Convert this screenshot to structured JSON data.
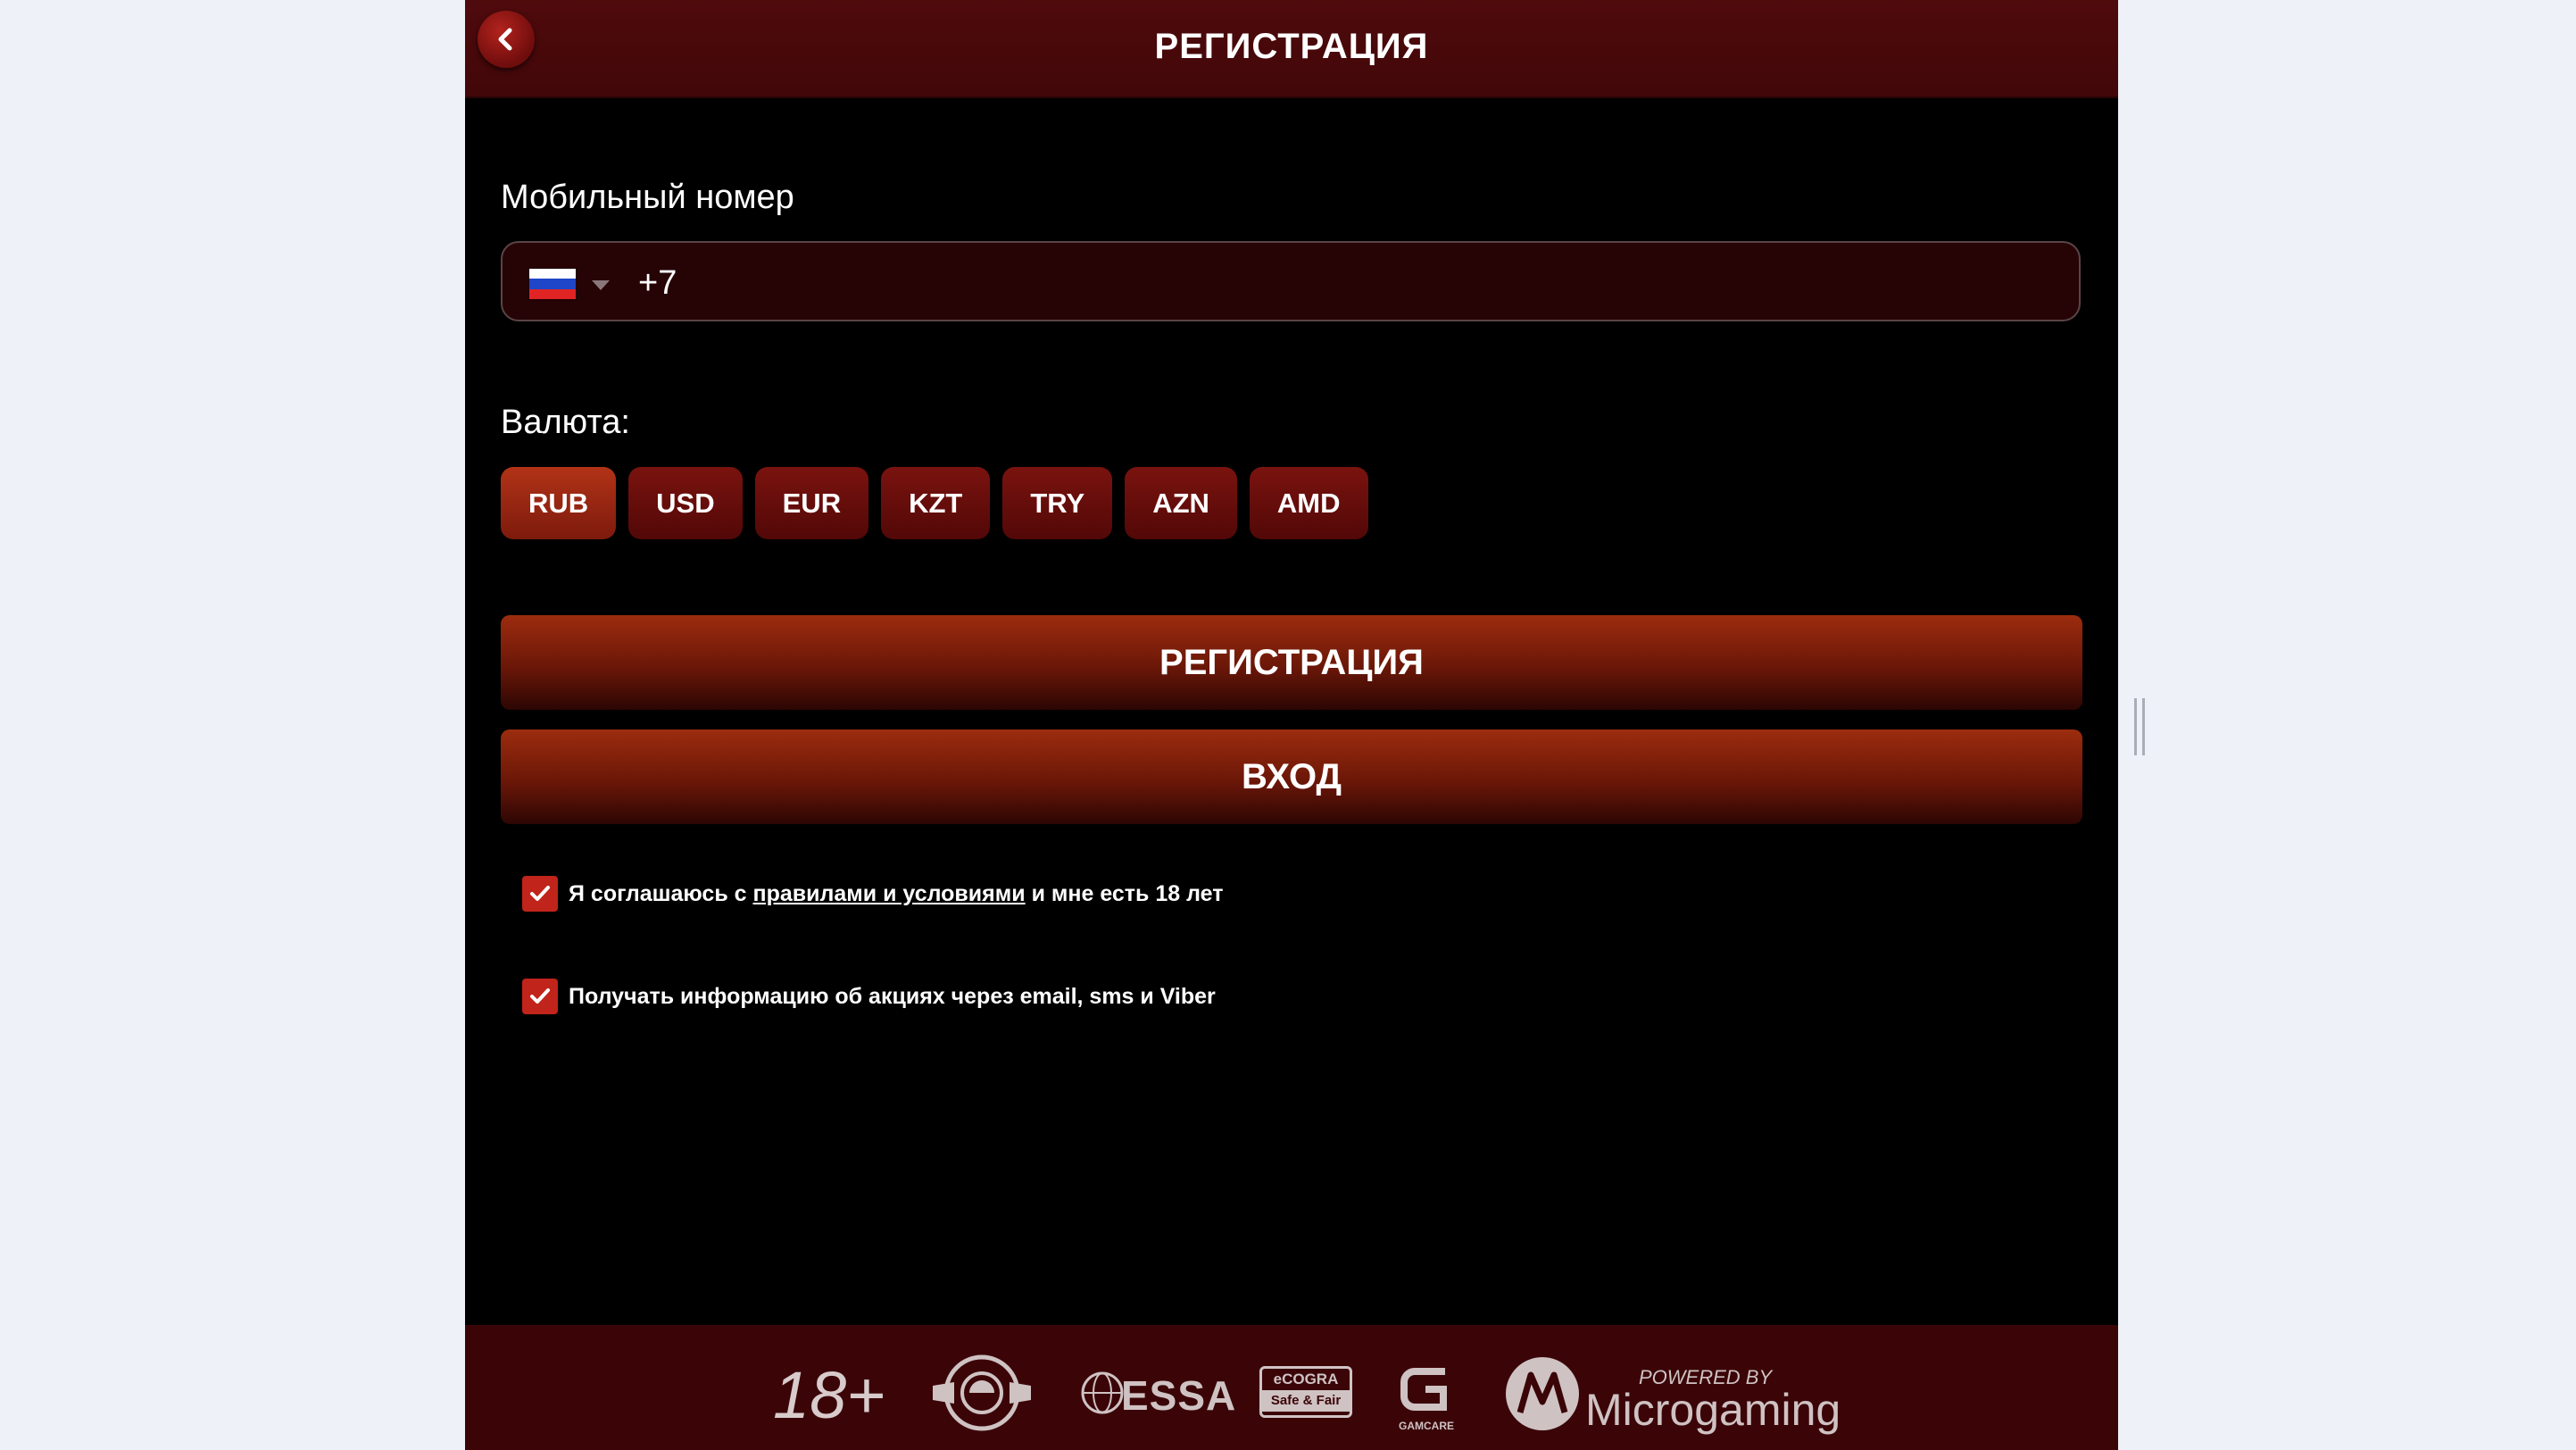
{
  "header": {
    "title": "РЕГИСТРАЦИЯ"
  },
  "phone": {
    "label": "Мобильный номер",
    "country": "RU",
    "prefix": "+7"
  },
  "currency": {
    "label": "Валюта:",
    "options": [
      "RUB",
      "USD",
      "EUR",
      "KZT",
      "TRY",
      "AZN",
      "AMD"
    ],
    "selected": "RUB"
  },
  "buttons": {
    "register": "РЕГИСТРАЦИЯ",
    "login": "ВХОД"
  },
  "terms": {
    "before": "Я соглашаюсь с ",
    "link": "правилами и условиями",
    "after": " и мне есть 18 лет",
    "checked": true
  },
  "promo": {
    "text": "Получать информацию об акциях через email, sms и Viber",
    "checked": true
  },
  "footer": {
    "age": "18+",
    "essa": "ESSA",
    "ecogra_top": "eCOGRA",
    "ecogra_bottom": "Safe & Fair",
    "gamcare": "GAMCARE",
    "powered_by": "POWERED BY",
    "microgaming": "Microgaming"
  },
  "colors": {
    "header": "#4a0709",
    "footer": "#3b0508",
    "accent": "#c1241a",
    "active_currency": "#b23316"
  }
}
